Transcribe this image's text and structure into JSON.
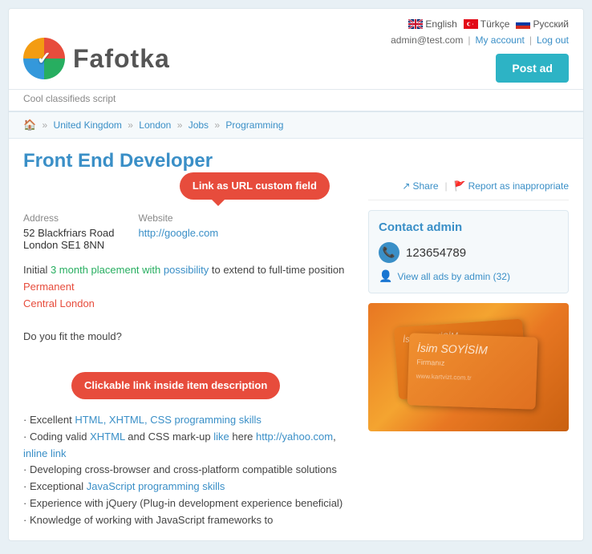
{
  "meta": {
    "site_name": "Fafotka",
    "tagline": "Cool classifieds script"
  },
  "header": {
    "languages": [
      {
        "name": "English",
        "flag": "uk",
        "active": true
      },
      {
        "name": "Türkçe",
        "flag": "tr",
        "active": false
      },
      {
        "name": "Русский",
        "flag": "ru",
        "active": false
      }
    ],
    "user_email": "admin@test.com",
    "my_account_label": "My account",
    "logout_label": "Log out",
    "post_ad_label": "Post ad"
  },
  "breadcrumb": {
    "home_icon": "🏠",
    "items": [
      "United Kingdom",
      "London",
      "Jobs",
      "Programming"
    ]
  },
  "listing": {
    "title": "Front End Developer",
    "annotation_url_field": "Link as URL  custom field",
    "annotation_clickable_link": "Clickable link inside item description",
    "address_label": "Address",
    "address_line1": "52 Blackfriars Road",
    "address_line2": "London SE1 8NN",
    "website_label": "Website",
    "website_url": "http://google.com",
    "share_label": "Share",
    "report_label": "Report as inappropriate",
    "contact_title": "Contact admin",
    "phone": "123654789",
    "view_ads_label": "View all ads by admin (32)",
    "description_lines": [
      "Initial 3 month placement with possibility to extend to full-time position",
      "Permanent",
      "Central London",
      "",
      "Do you fit the mould?",
      "",
      "· Excellent HTML, XHTML, CSS programming skills",
      "· Coding valid XHTML and CSS mark-up like here http://yahoo.com, inline link",
      "· Developing cross-browser and cross-platform compatible solutions",
      "· Exceptional JavaScript programming skills",
      "· Experience with jQuery (Plug-in development experience beneficial)",
      "· Knowledge of working with JavaScript frameworks to"
    ]
  }
}
